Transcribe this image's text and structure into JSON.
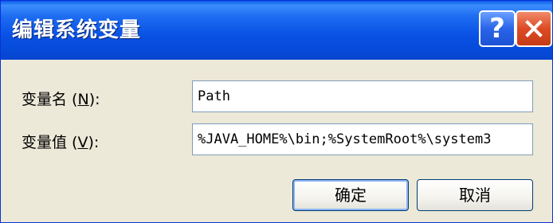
{
  "window": {
    "title": "编辑系统变量",
    "help_label": "?",
    "close_icon": "close-icon"
  },
  "form": {
    "name_label": "变量名",
    "name_mnemonic": "N",
    "name_value": "Path",
    "value_label": "变量值",
    "value_mnemonic": "V",
    "value_value": "%JAVA_HOME%\\bin;%SystemRoot%\\system3"
  },
  "buttons": {
    "ok_label": "确定",
    "cancel_label": "取消"
  }
}
